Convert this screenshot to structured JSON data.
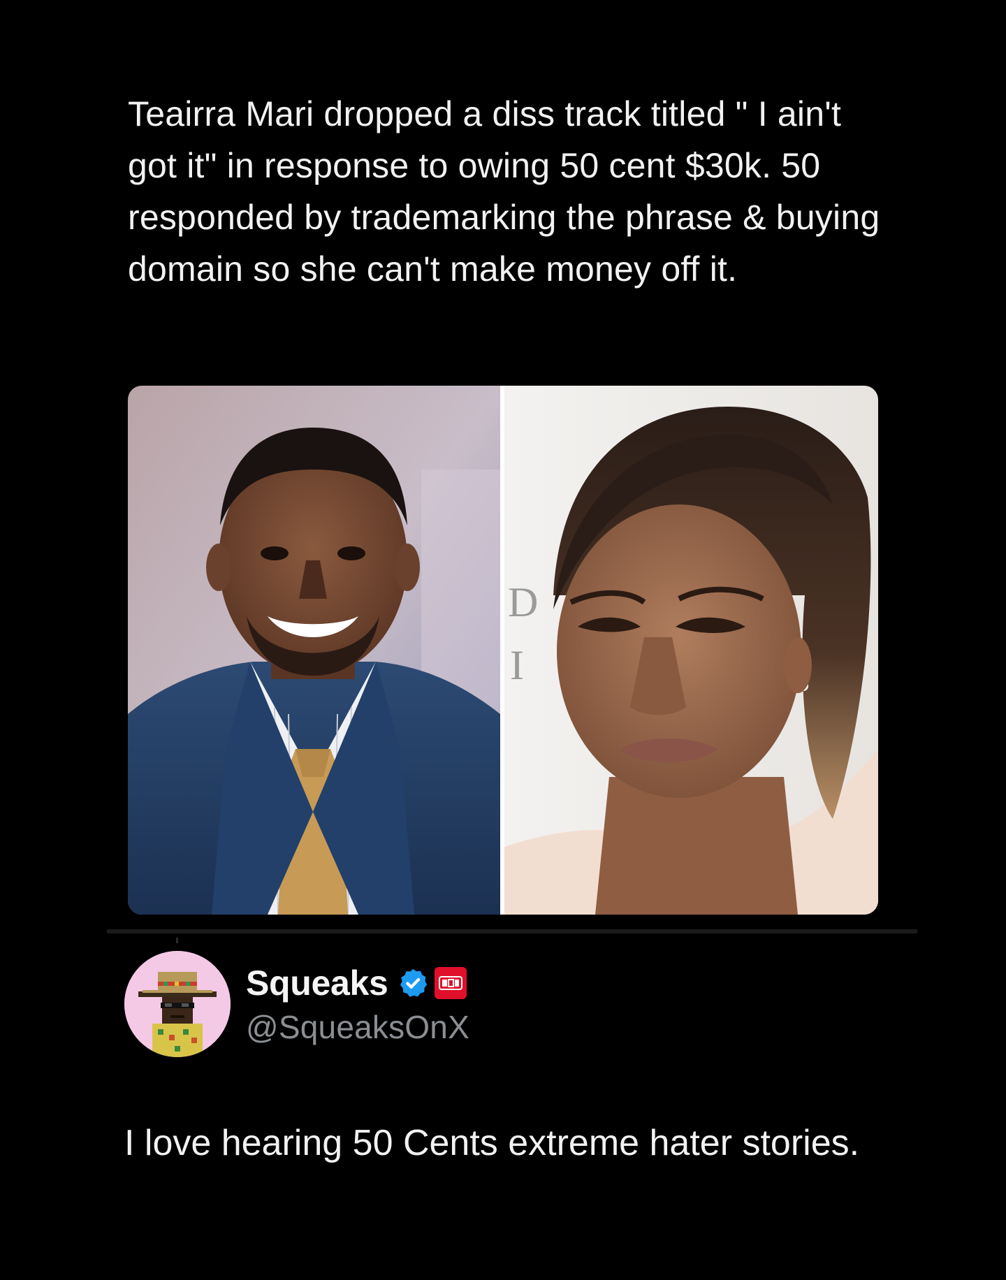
{
  "quoted_post": {
    "text": "Teairra Mari dropped a diss track titled \" I ain't got it\" in response to owing 50 cent $30k. 50 responded by trademarking the phrase & buying domain so she can't make money off it."
  },
  "media": {
    "left_image_label": "man-in-blue-suit-smiling-photo",
    "right_image_label": "woman-with-ponytail-photo"
  },
  "reply": {
    "author": {
      "display_name": "Squeaks",
      "handle": "@SqueaksOnX",
      "verified_icon": "verified-badge-icon",
      "affiliate_icon": "affiliate-badge-icon"
    },
    "text": "I love hearing 50 Cents extreme hater stories."
  },
  "colors": {
    "background": "#000000",
    "text": "#f2f2f2",
    "secondary_text": "#8b8f94",
    "verified": "#1d9bf0",
    "affiliate": "#e0102a",
    "avatar_bg": "#f4c9e6"
  }
}
